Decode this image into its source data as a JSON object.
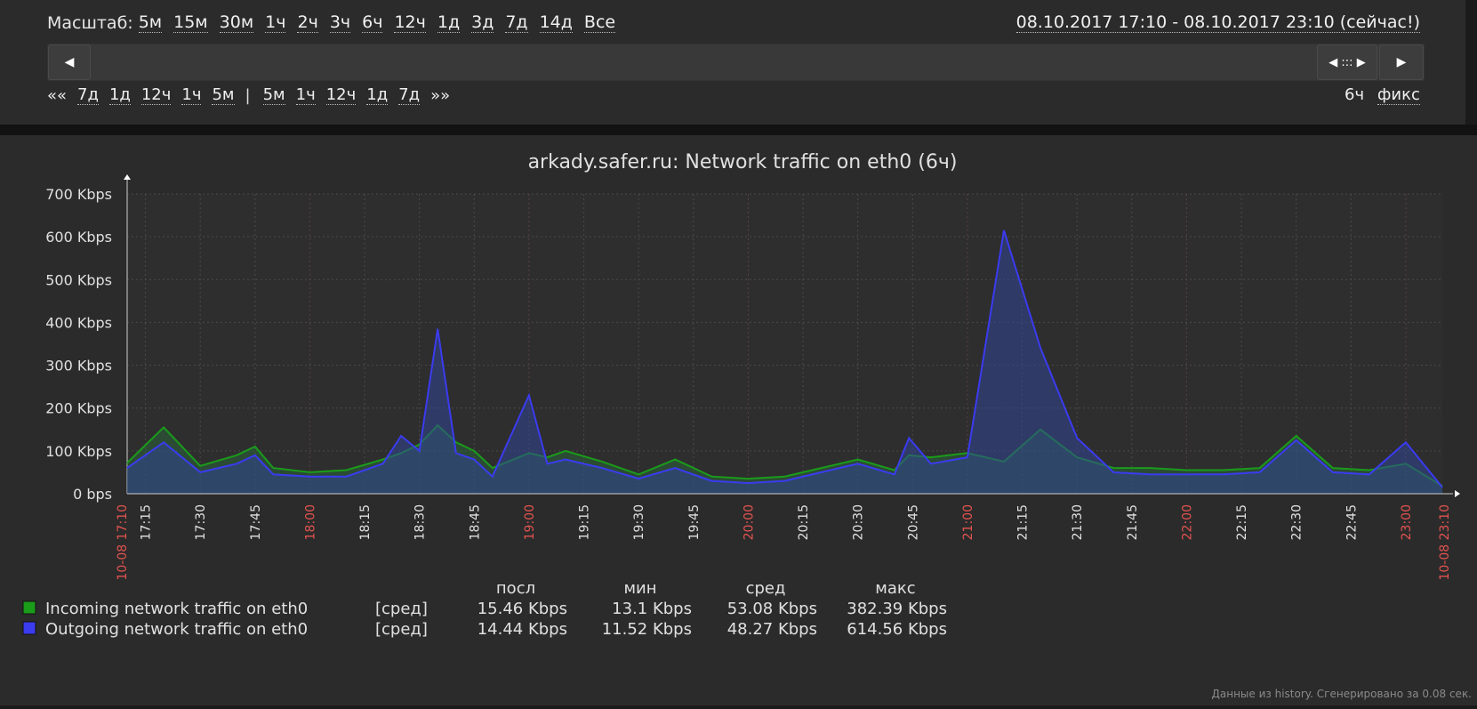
{
  "filter": {
    "scale_label": "Масштаб:",
    "zoom_links": [
      "5м",
      "15м",
      "30м",
      "1ч",
      "2ч",
      "3ч",
      "6ч",
      "12ч",
      "1д",
      "3д",
      "7д",
      "14д",
      "Все"
    ],
    "time_range": "08.10.2017 17:10 - 08.10.2017 23:10 (сейчас!)",
    "nav_back_first": "««",
    "nav_back": [
      "7д",
      "1д",
      "12ч",
      "1ч",
      "5м"
    ],
    "nav_separator": "|",
    "nav_forward": [
      "5м",
      "1ч",
      "12ч",
      "1д",
      "7д"
    ],
    "nav_forward_last": "»»",
    "period": "6ч",
    "fixed": "фикс",
    "scroll_left": "◀",
    "scroll_center": "◀ ::: ▶",
    "scroll_right": "▶"
  },
  "chart_data": {
    "type": "area",
    "title": "arkady.safer.ru: Network traffic on eth0 (6ч)",
    "y_ticks": [
      "0 bps",
      "100 Kbps",
      "200 Kbps",
      "300 Kbps",
      "400 Kbps",
      "500 Kbps",
      "600 Kbps",
      "700 Kbps"
    ],
    "ylim": [
      0,
      700
    ],
    "y_unit": "Kbps",
    "x_start_label": "10-08 17:10",
    "x_end_label": "10-08 23:10",
    "x_ticks": [
      {
        "label": "17:15",
        "red": false
      },
      {
        "label": "17:30",
        "red": false
      },
      {
        "label": "17:45",
        "red": false
      },
      {
        "label": "18:00",
        "red": true
      },
      {
        "label": "18:15",
        "red": false
      },
      {
        "label": "18:30",
        "red": false
      },
      {
        "label": "18:45",
        "red": false
      },
      {
        "label": "19:00",
        "red": true
      },
      {
        "label": "19:15",
        "red": false
      },
      {
        "label": "19:30",
        "red": false
      },
      {
        "label": "19:45",
        "red": false
      },
      {
        "label": "20:00",
        "red": true
      },
      {
        "label": "20:15",
        "red": false
      },
      {
        "label": "20:30",
        "red": false
      },
      {
        "label": "20:45",
        "red": false
      },
      {
        "label": "21:00",
        "red": true
      },
      {
        "label": "21:15",
        "red": false
      },
      {
        "label": "21:30",
        "red": false
      },
      {
        "label": "21:45",
        "red": false
      },
      {
        "label": "22:00",
        "red": true
      },
      {
        "label": "22:15",
        "red": false
      },
      {
        "label": "22:30",
        "red": false
      },
      {
        "label": "22:45",
        "red": false
      },
      {
        "label": "23:00",
        "red": true
      }
    ],
    "x_minutes": [
      0,
      10,
      20,
      30,
      35,
      40,
      50,
      60,
      70,
      75,
      80,
      85,
      90,
      95,
      100,
      110,
      115,
      120,
      130,
      140,
      150,
      160,
      170,
      180,
      190,
      200,
      210,
      214,
      220,
      230,
      240,
      250,
      260,
      270,
      280,
      290,
      300,
      310,
      320,
      330,
      340,
      350,
      360
    ],
    "series": [
      {
        "name": "Incoming network traffic on eth0",
        "color": "#1a9c1a",
        "values": [
          72,
          155,
          65,
          90,
          110,
          60,
          50,
          55,
          80,
          95,
          115,
          160,
          120,
          100,
          60,
          95,
          85,
          100,
          75,
          45,
          80,
          40,
          35,
          40,
          60,
          80,
          55,
          90,
          85,
          95,
          75,
          150,
          85,
          60,
          60,
          55,
          55,
          60,
          135,
          60,
          55,
          70,
          18
        ]
      },
      {
        "name": "Outgoing network traffic on eth0",
        "color": "#3b3bf0",
        "values": [
          60,
          120,
          50,
          70,
          90,
          45,
          40,
          40,
          70,
          135,
          100,
          385,
          95,
          80,
          40,
          230,
          70,
          80,
          60,
          35,
          60,
          30,
          25,
          30,
          50,
          70,
          45,
          130,
          70,
          85,
          615,
          340,
          130,
          50,
          45,
          45,
          45,
          50,
          125,
          50,
          45,
          120,
          15
        ]
      }
    ],
    "legend": {
      "headers": [
        "посл",
        "мин",
        "сред",
        "макс"
      ],
      "rows": [
        {
          "name": "Incoming network traffic on eth0",
          "func": "[сред]",
          "last": "15.46 Kbps",
          "min": "13.1 Kbps",
          "avg": "53.08 Kbps",
          "max": "382.39 Kbps",
          "color": "#1a9c1a"
        },
        {
          "name": "Outgoing network traffic on eth0",
          "func": "[сред]",
          "last": "14.44 Kbps",
          "min": "11.52 Kbps",
          "avg": "48.27 Kbps",
          "max": "614.56 Kbps",
          "color": "#3b3bf0"
        }
      ]
    }
  },
  "footer": "Данные из history. Сгенерировано за 0.08 сек."
}
